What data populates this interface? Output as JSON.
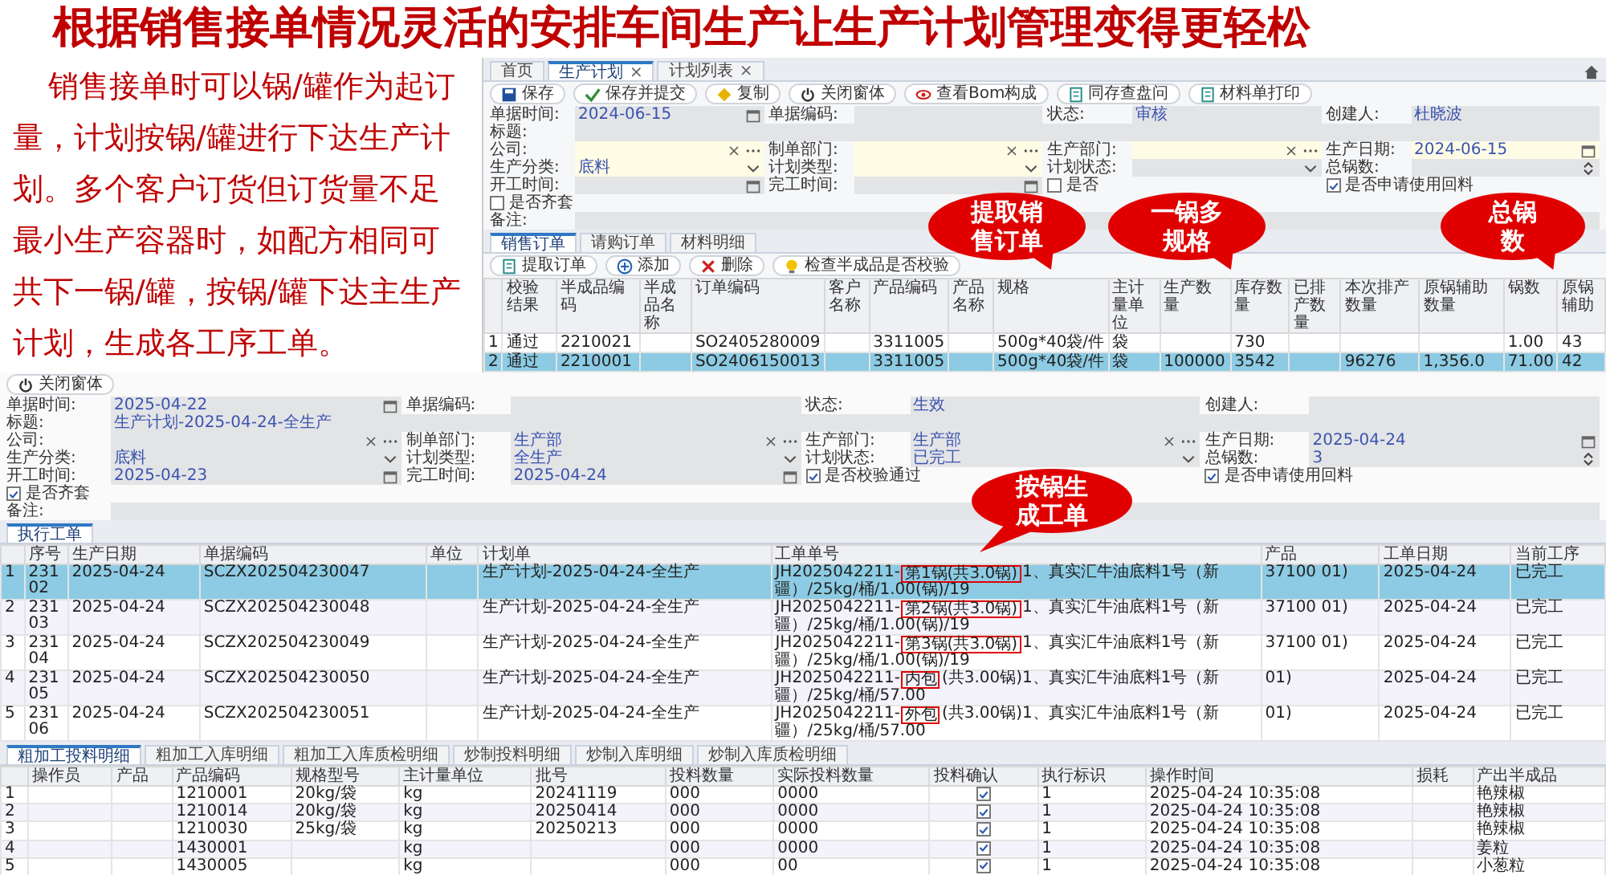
{
  "title": "根据销售接单情况灵活的安排车间生产让生产计划管理变得更轻松",
  "description": "销售接单时可以锅/罐作为起订量，计划按锅/罐进行下达生产计划。多个客户订货但订货量不足最小生产容器时，如配方相同可共下一锅/罐，按锅/罐下达主生产计划，生成各工序工单。",
  "plan_window": {
    "tabs": [
      {
        "label": "首页",
        "selected": false
      },
      {
        "label": "生产计划",
        "close": "×",
        "selected": true
      },
      {
        "label": "计划列表",
        "close": "×",
        "selected": false
      }
    ],
    "toolbar": [
      {
        "label": "保存"
      },
      {
        "label": "保存并提交"
      },
      {
        "label": "复制"
      },
      {
        "label": "关闭窗体"
      },
      {
        "label": "查看Bom构成"
      },
      {
        "label": "同存查盘问"
      },
      {
        "label": "材料单打印"
      }
    ],
    "form": [
      [
        {
          "label": "单据时间:",
          "kind": "date",
          "value": "2024-06-15",
          "editable": false
        },
        {
          "label": "单据编码:",
          "kind": "text",
          "editable": false
        },
        {
          "label": "状态:",
          "kind": "text",
          "value": "审核",
          "editable": false
        },
        {
          "label": "创建人:",
          "kind": "text",
          "value": "杜晓波",
          "editable": false
        }
      ],
      [
        {
          "label": "标题:",
          "kind": "wide",
          "editable": false
        }
      ],
      [
        {
          "label": "公司:",
          "kind": "picker",
          "editable": true
        },
        {
          "label": "制单部门:",
          "kind": "picker",
          "editable": true
        },
        {
          "label": "生产部门:",
          "kind": "picker",
          "editable": true
        },
        {
          "label": "生产日期:",
          "kind": "date",
          "value": "2024-06-15",
          "editable": true
        }
      ],
      [
        {
          "label": "生产分类:",
          "kind": "select",
          "value": "底料",
          "editable": true
        },
        {
          "label": "计划类型:",
          "kind": "select",
          "editable": true
        },
        {
          "label": "计划状态:",
          "kind": "select",
          "editable": false
        },
        {
          "label": "总锅数:",
          "kind": "number",
          "editable": false
        }
      ],
      [
        {
          "label": "开工时间:",
          "kind": "date",
          "editable": false
        },
        {
          "label": "完工时间:",
          "kind": "date",
          "editable": false
        },
        {
          "label": "是否",
          "kind": "checkbox",
          "checked": false
        },
        {
          "label": "是否申请使用回料",
          "kind": "checkbox",
          "checked": true
        }
      ],
      [
        {
          "label": "是否齐套",
          "kind": "checkbox",
          "checked": false
        }
      ],
      [
        {
          "label": "备注:",
          "kind": "wide",
          "editable": false
        }
      ]
    ],
    "detail_tabs": [
      {
        "label": "销售订单",
        "selected": true
      },
      {
        "label": "请购订单",
        "selected": false
      },
      {
        "label": "材料明细",
        "selected": false
      }
    ],
    "detail_toolbar": [
      {
        "label": "提取订单"
      },
      {
        "label": "添加"
      },
      {
        "label": "删除"
      },
      {
        "label": "检查半成品是否校验"
      }
    ],
    "table": {
      "columns": [
        "",
        "校验结果",
        "半成品编码",
        "半成品名称",
        "订单编码",
        "客户名称",
        "产品编码",
        "产品名称",
        "规格",
        "主计量单位",
        "生产数量",
        "库存数量",
        "已排产数量",
        "本次排产数量",
        "原锅辅助数量",
        "锅数",
        "原锅辅助"
      ],
      "rows": [
        {
          "selected": false,
          "cells": [
            "1",
            "通过",
            "2210021",
            null,
            "SO2405280009",
            null,
            "3311005",
            null,
            "500g*40袋/件",
            "袋",
            null,
            "730",
            null,
            null,
            null,
            "1.00",
            "43"
          ]
        },
        {
          "selected": true,
          "cells": [
            "2",
            "通过",
            "2210001",
            null,
            "SO2406150013",
            null,
            "3311005",
            null,
            "500g*40袋/件",
            "袋",
            "100000",
            "3542",
            null,
            "96276",
            "1,356.0",
            "71.00",
            "42"
          ]
        }
      ]
    }
  },
  "callouts": [
    {
      "text": "提取销售订单"
    },
    {
      "text": "一锅多规格"
    },
    {
      "text": "总锅数"
    },
    {
      "text": "按锅生成工单"
    }
  ],
  "order_window": {
    "toolbar": [
      {
        "label": "关闭窗体"
      }
    ],
    "form": [
      [
        {
          "label": "单据时间:",
          "kind": "date",
          "value": "2025-04-22",
          "editable": false
        },
        {
          "label": "单据编码:",
          "kind": "text",
          "editable": false
        },
        {
          "label": "状态:",
          "kind": "text",
          "value": "生效",
          "editable": false
        },
        {
          "label": "创建人:",
          "kind": "text",
          "editable": false
        }
      ],
      [
        {
          "label": "标题:",
          "kind": "wide",
          "value": "生产计划-2025-04-24-全生产",
          "editable": false
        }
      ],
      [
        {
          "label": "公司:",
          "kind": "picker",
          "editable": false
        },
        {
          "label": "制单部门:",
          "kind": "picker",
          "value": "生产部",
          "editable": false
        },
        {
          "label": "生产部门:",
          "kind": "picker",
          "value": "生产部",
          "editable": false
        },
        {
          "label": "生产日期:",
          "kind": "date",
          "value": "2025-04-24",
          "editable": false
        }
      ],
      [
        {
          "label": "生产分类:",
          "kind": "select",
          "value": "底料",
          "editable": false
        },
        {
          "label": "计划类型:",
          "kind": "select",
          "value": "全生产",
          "editable": false
        },
        {
          "label": "计划状态:",
          "kind": "select",
          "value": "已完工",
          "editable": false
        },
        {
          "label": "总锅数:",
          "kind": "number",
          "value": "3",
          "editable": false
        }
      ],
      [
        {
          "label": "开工时间:",
          "kind": "date",
          "value": "2025-04-23",
          "editable": false
        },
        {
          "label": "完工时间:",
          "kind": "date",
          "value": "2025-04-24",
          "editable": false
        },
        {
          "label": "是否校验通过",
          "kind": "checkbox",
          "checked": true
        },
        {
          "label": "是否申请使用回料",
          "kind": "checkbox",
          "checked": true
        }
      ],
      [
        {
          "label": "是否齐套",
          "kind": "checkbox",
          "checked": true
        }
      ],
      [
        {
          "label": "备注:",
          "kind": "wide",
          "editable": false
        }
      ]
    ],
    "detail_tabs": [
      {
        "label": "执行工单",
        "selected": true
      }
    ],
    "table": {
      "columns": [
        "",
        "序号",
        "生产日期",
        "单据编码",
        "单位",
        "计划单",
        "工单单号",
        "产品",
        "工单日期",
        "当前工序"
      ],
      "rows": [
        {
          "selected": true,
          "cells": [
            "1",
            "23102",
            "2025-04-24",
            "SCZX202504230047",
            null,
            "生产计划-2025-04-24-全生产",
            {
              "kind": "marked",
              "prefix": "JH2025042211-",
              "mark": "第1锅(共3.0锅)",
              "rest": "1、真实汇牛油底料1号（新疆）/25kg/桶/1.00(锅)/19"
            },
            "37100 01)",
            "2025-04-24",
            "已完工"
          ]
        },
        {
          "selected": false,
          "cells": [
            "2",
            "23103",
            "2025-04-24",
            "SCZX202504230048",
            null,
            "生产计划-2025-04-24-全生产",
            {
              "kind": "marked",
              "prefix": "JH2025042211-",
              "mark": "第2锅(共3.0锅)",
              "rest": "1、真实汇牛油底料1号（新疆）/25kg/桶/1.00(锅)/19"
            },
            "37100 01)",
            "2025-04-24",
            "已完工"
          ]
        },
        {
          "selected": false,
          "cells": [
            "3",
            "23104",
            "2025-04-24",
            "SCZX202504230049",
            null,
            "生产计划-2025-04-24-全生产",
            {
              "kind": "marked",
              "prefix": "JH2025042211-",
              "mark": "第3锅(共3.0锅)",
              "rest": "1、真实汇牛油底料1号（新疆）/25kg/桶/1.00(锅)/19"
            },
            "37100 01)",
            "2025-04-24",
            "已完工"
          ]
        },
        {
          "selected": false,
          "cells": [
            "4",
            "23105",
            "2025-04-24",
            "SCZX202504230050",
            null,
            "生产计划-2025-04-24-全生产",
            {
              "kind": "marked",
              "prefix": "JH2025042211-",
              "mark": "内包",
              "rest": "(共3.00锅)1、真实汇牛油底料1号（新疆）/25kg/桶/57.00"
            },
            "01)",
            "2025-04-24",
            "已完工"
          ]
        },
        {
          "selected": false,
          "cells": [
            "5",
            "23106",
            "2025-04-24",
            "SCZX202504230051",
            null,
            "生产计划-2025-04-24-全生产",
            {
              "kind": "marked",
              "prefix": "JH2025042211-",
              "mark": "外包",
              "rest": "(共3.00锅)1、真实汇牛油底料1号（新疆）/25kg/桶/57.00"
            },
            "01)",
            "2025-04-24",
            "已完工"
          ]
        }
      ]
    },
    "sub_tabs": [
      {
        "label": "粗加工投料明细",
        "selected": true
      },
      {
        "label": "粗加工入库明细",
        "selected": false
      },
      {
        "label": "粗加工入库质检明细",
        "selected": false
      },
      {
        "label": "炒制投料明细",
        "selected": false
      },
      {
        "label": "炒制入库明细",
        "selected": false
      },
      {
        "label": "炒制入库质检明细",
        "selected": false
      }
    ],
    "sub_table": {
      "columns": [
        "",
        "操作员",
        "产品",
        "产品编码",
        "规格型号",
        "主计量单位",
        "批号",
        "投料数量",
        "实际投料数量",
        "投料确认",
        "执行标识",
        "操作时间",
        "损耗",
        "产出半成品"
      ],
      "rows": [
        {
          "selected": false,
          "cells": [
            "1",
            null,
            null,
            "1210001",
            "20kg/袋",
            "kg",
            "20241119",
            "000",
            "0000",
            {
              "kind": "checkbox",
              "checked": true
            },
            "1",
            "2025-04-24 10:35:08",
            null,
            "艳辣椒"
          ]
        },
        {
          "selected": false,
          "cells": [
            "2",
            null,
            null,
            "1210014",
            "20kg/袋",
            "kg",
            "20250414",
            "000",
            "0000",
            {
              "kind": "checkbox",
              "checked": true
            },
            "1",
            "2025-04-24 10:35:08",
            null,
            "艳辣椒"
          ]
        },
        {
          "selected": false,
          "cells": [
            "3",
            null,
            null,
            "1210030",
            "25kg/袋",
            "kg",
            "20250213",
            "000",
            "0000",
            {
              "kind": "checkbox",
              "checked": true
            },
            "1",
            "2025-04-24 10:35:08",
            null,
            "艳辣椒"
          ]
        },
        {
          "selected": false,
          "cells": [
            "4",
            null,
            null,
            "1430001",
            null,
            "kg",
            null,
            "000",
            "0000",
            {
              "kind": "checkbox",
              "checked": true
            },
            "1",
            "2025-04-24 10:35:08",
            null,
            "姜粒"
          ]
        },
        {
          "selected": false,
          "cells": [
            "5",
            null,
            null,
            "1430005",
            null,
            "kg",
            null,
            "000",
            "00",
            {
              "kind": "checkbox",
              "checked": true
            },
            "1",
            "2025-04-24 10:35:08",
            null,
            "小葱粒"
          ]
        }
      ]
    }
  }
}
